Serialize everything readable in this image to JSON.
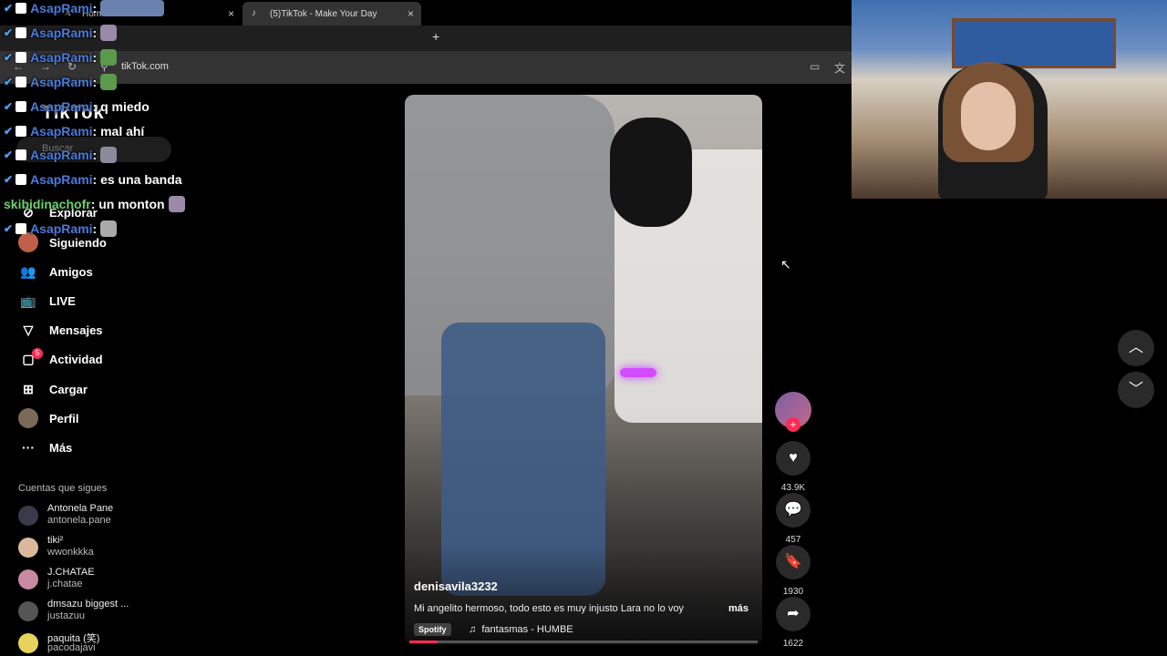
{
  "browser": {
    "tabs": [
      {
        "label": "Home",
        "close": "×"
      },
      {
        "label": "(5)TikTok - Make Your Day",
        "close": "×"
      }
    ],
    "new_tab": "+",
    "url": "tikTok.com"
  },
  "sidebar": {
    "logo": "TikTok",
    "search_placeholder": "Buscar",
    "nav": [
      {
        "label": "Explorar",
        "icon": "compass-icon"
      },
      {
        "label": "Siguiendo",
        "icon": "avatar"
      },
      {
        "label": "Amigos",
        "icon": "users-icon"
      },
      {
        "label": "LIVE",
        "icon": "live-icon"
      },
      {
        "label": "Mensajes",
        "icon": "send-icon"
      },
      {
        "label": "Actividad",
        "icon": "activity-icon",
        "badge": "5"
      },
      {
        "label": "Cargar",
        "icon": "plus-square-icon"
      },
      {
        "label": "Perfil",
        "icon": "avatar"
      },
      {
        "label": "Más",
        "icon": "more-icon"
      }
    ],
    "following_title": "Cuentas que sigues",
    "following": [
      {
        "name": "Antonela Pane",
        "user": "antonela.pane"
      },
      {
        "name": "tiki²",
        "user": "wwonkkka"
      },
      {
        "name": "J.CHATAE",
        "user": "j.chatae"
      },
      {
        "name": "dmsazu biggest ...",
        "user": "justazuu"
      },
      {
        "name": "paquita (笑)",
        "user": "pacodajavi"
      }
    ]
  },
  "chat": [
    {
      "user": "AsapRami",
      "text": ":"
    },
    {
      "user": "AsapRami",
      "text": ":"
    },
    {
      "user": "AsapRami",
      "text": ":"
    },
    {
      "user": "AsapRami",
      "text": ":"
    },
    {
      "user": "AsapRami",
      "text": ": q miedo"
    },
    {
      "user": "AsapRami",
      "text": ": mal ahí"
    },
    {
      "user": "AsapRami",
      "text": ":"
    },
    {
      "user": "AsapRami",
      "text": ": es una banda"
    },
    {
      "user": "skibidinachofr",
      "text": ": un monton"
    },
    {
      "user": "AsapRami",
      "text": ":"
    }
  ],
  "video": {
    "username": "denisavila3232",
    "description": "Mi angelito hermoso, todo esto es muy injusto Lara no lo voy",
    "more": "más",
    "spotify": "Spotify",
    "music": "fantasmas - HUMBE",
    "progress": 0.08
  },
  "actions": {
    "likes": "43.9K",
    "comments": "457",
    "saves": "1930",
    "shares": "1622"
  },
  "colors": {
    "accent": "#fe2c55",
    "chat_user": "#4b7bd8",
    "chat_user2": "#6fd26a"
  }
}
